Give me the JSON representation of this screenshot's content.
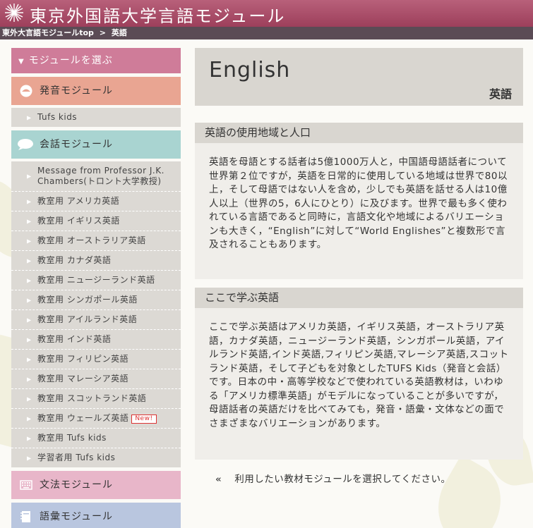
{
  "header": {
    "title": "東京外国語大学言語モジュール"
  },
  "breadcrumb": {
    "home": "東外大言語モジュールtop",
    "separator": ">",
    "current": "英語"
  },
  "sidebar": {
    "heading": "モジュールを選ぶ",
    "modules": {
      "sound": {
        "label": "発音モジュール",
        "icon": "face-icon"
      },
      "talk": {
        "label": "会話モジュール",
        "icon": "speech-bubble-icon"
      },
      "grammar": {
        "label": "文法モジュール",
        "icon": "keyboard-icon"
      },
      "vocab": {
        "label": "語彙モジュール",
        "icon": "notebook-icon"
      }
    },
    "sound_items": [
      "Tufs kids"
    ],
    "talk_items": [
      "Message from Professor J.K. Chambers(トロント大学教授)",
      "教室用 アメリカ英語",
      "教室用 イギリス英語",
      "教室用 オーストラリア英語",
      "教室用 カナダ英語",
      "教室用 ニュージーランド英語",
      "教室用 シンガポール英語",
      "教室用 アイルランド英語",
      "教室用 インド英語",
      "教室用 フィリピン英語",
      "教室用 マレーシア英語",
      "教室用 スコットランド英語",
      "教室用 ウェールズ英語",
      "教室用 Tufs kids",
      "学習者用 Tufs kids"
    ],
    "new_badge": "New!"
  },
  "main": {
    "title_en": "English",
    "title_ja": "英語",
    "section1": {
      "heading": "英語の使用地域と人口",
      "body": "英語を母語とする話者は5億1000万人と，中国語母語話者について世界第２位ですが，英語を日常的に使用している地域は世界で80以上，そして母語ではない人を含め，少しでも英語を話せる人は10億人以上（世界の5，6人にひとり）に及びます。世界で最も多く使われている言語であると同時に，言語文化や地域によるバリエーションも大きく，“English”に対して“World Englishes”と複数形で言及されることもあります。"
    },
    "section2": {
      "heading": "ここで学ぶ英語",
      "body": "ここで学ぶ英語はアメリカ英語，イギリス英語，オーストラリア英語，カナダ英語，ニュージーランド英語，シンガポール英語，アイルランド英語,インド英語,フィリピン英語,マレーシア英語,スコットランド英語，そして子どもを対象としたTUFS Kids（発音と会話）です。日本の中・高等学校などで使われている英語教材は，いわゆる「アメリカ標準英語」がモデルになっていることが多いですが，母語話者の英語だけを比べてみても，発音・語彙・文体などの面でさまざまなバリエーションがあります。"
    },
    "hint": {
      "icon": "double-chevron-left-icon",
      "text": "利用したい教材モジュールを選択してください。"
    }
  },
  "colors": {
    "header": "#9d3f5b",
    "breadcrumb": "#5b4b55",
    "sidebar_heading": "#cf7c99",
    "sound_module": "#e9a592",
    "talk_module": "#a9d4d1",
    "grammar_module": "#e8b6c9",
    "vocab_module": "#b9c6df",
    "panel": "#d9d6d0"
  }
}
